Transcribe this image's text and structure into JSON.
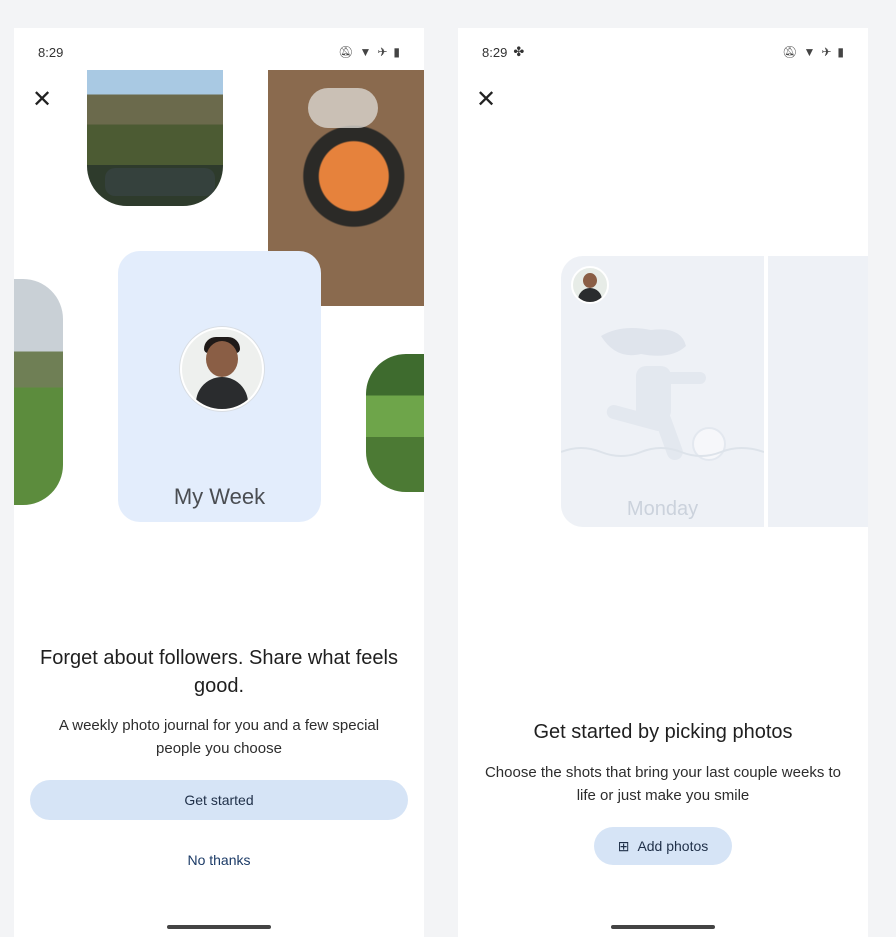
{
  "screen1": {
    "status_time": "8:29",
    "card_title": "My Week",
    "headline": "Forget about followers. Share what feels good.",
    "subtext": "A weekly photo journal for you and a few special people you choose",
    "primary_button": "Get started",
    "secondary_button": "No thanks"
  },
  "screen2": {
    "status_time": "8:29",
    "day_label": "Monday",
    "headline": "Get started by picking photos",
    "subtext": "Choose the shots that bring your last couple weeks to life or just make you smile",
    "add_button": "Add photos"
  },
  "icons": {
    "close": "close-icon",
    "status": [
      "mute-icon",
      "wifi-icon",
      "airplane-icon",
      "battery-icon"
    ],
    "pinwheel": "pinwheel-icon",
    "add_photo": "add-photo-icon"
  },
  "colors": {
    "card_bg": "#e3edfc",
    "button_bg": "#d6e4f6",
    "link": "#1b3a66"
  }
}
